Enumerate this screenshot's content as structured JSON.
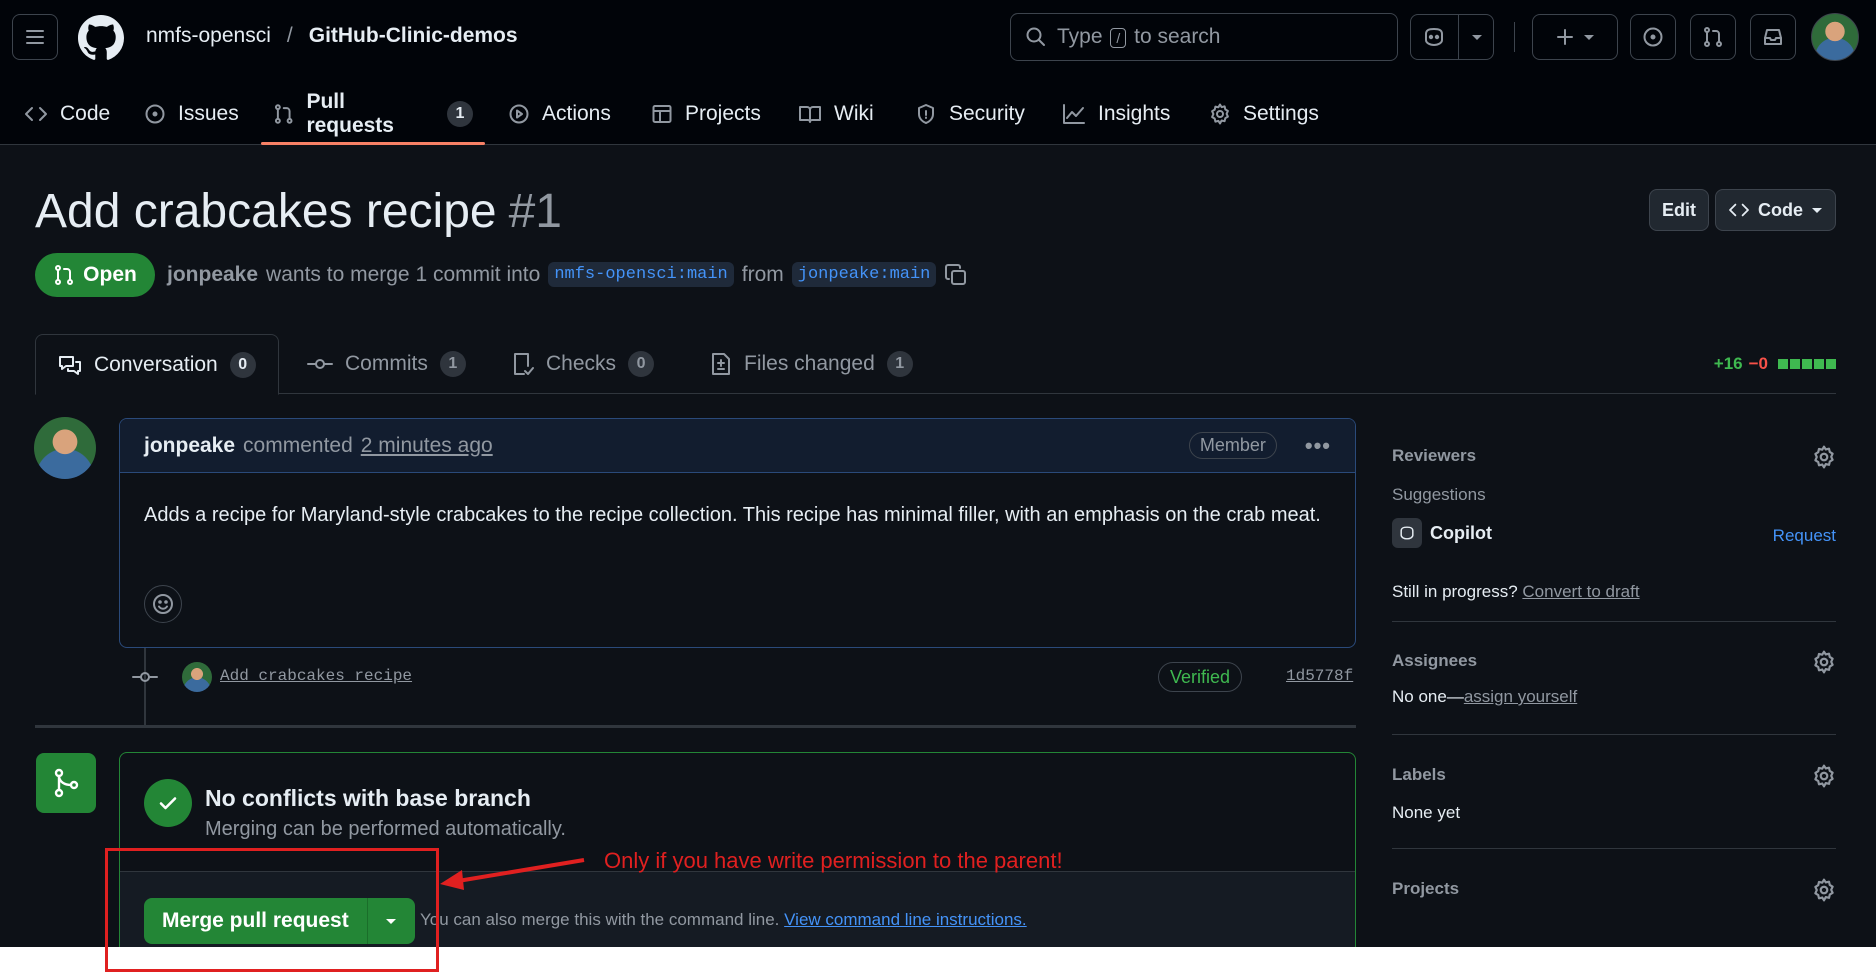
{
  "header": {
    "owner": "nmfs-opensci",
    "separator": "/",
    "repo": "GitHub-Clinic-demos",
    "search_pre": "Type",
    "search_key": "/",
    "search_post": "to search"
  },
  "repo_nav": {
    "code": "Code",
    "issues": "Issues",
    "pull_requests": "Pull requests",
    "pull_requests_count": "1",
    "actions": "Actions",
    "projects": "Projects",
    "wiki": "Wiki",
    "security": "Security",
    "insights": "Insights",
    "settings": "Settings"
  },
  "pr": {
    "title": "Add crabcakes recipe",
    "number": "#1",
    "edit_label": "Edit",
    "code_label": "Code",
    "state": "Open",
    "author": "jonpeake",
    "meta_middle": "wants to merge 1 commit into",
    "base_branch": "nmfs-opensci:main",
    "from_word": "from",
    "head_branch": "jonpeake:main"
  },
  "pr_tabs": {
    "conversation": "Conversation",
    "conversation_count": "0",
    "commits": "Commits",
    "commits_count": "1",
    "checks": "Checks",
    "checks_count": "0",
    "files": "Files changed",
    "files_count": "1",
    "additions": "+16",
    "deletions": "−0"
  },
  "comment": {
    "author": "jonpeake",
    "action": "commented",
    "time": "2 minutes ago",
    "role": "Member",
    "body": "Adds a recipe for Maryland-style crabcakes to the recipe collection. This recipe has minimal filler, with an emphasis on the crab meat."
  },
  "commit": {
    "message": "Add crabcakes recipe",
    "verified": "Verified",
    "sha": "1d5778f"
  },
  "merge": {
    "title": "No conflicts with base branch",
    "subtitle": "Merging can be performed automatically.",
    "button": "Merge pull request",
    "cli_note": "You can also merge this with the command line.",
    "cli_link": "View command line instructions."
  },
  "sidebar": {
    "reviewers": "Reviewers",
    "suggestions": "Suggestions",
    "copilot": "Copilot",
    "request": "Request",
    "in_progress": "Still in progress?",
    "convert": "Convert to draft",
    "assignees": "Assignees",
    "no_one": "No one—",
    "assign_yourself": "assign yourself",
    "labels": "Labels",
    "none_yet": "None yet",
    "projects": "Projects"
  },
  "annotation": {
    "text": "Only if you have write permission to the parent!"
  },
  "colors": {
    "bg": "#0d1117",
    "header_bg": "#010409",
    "green": "#238636",
    "link": "#4493f8",
    "annotation_red": "#e02020",
    "tab_underline": "#f78166"
  }
}
